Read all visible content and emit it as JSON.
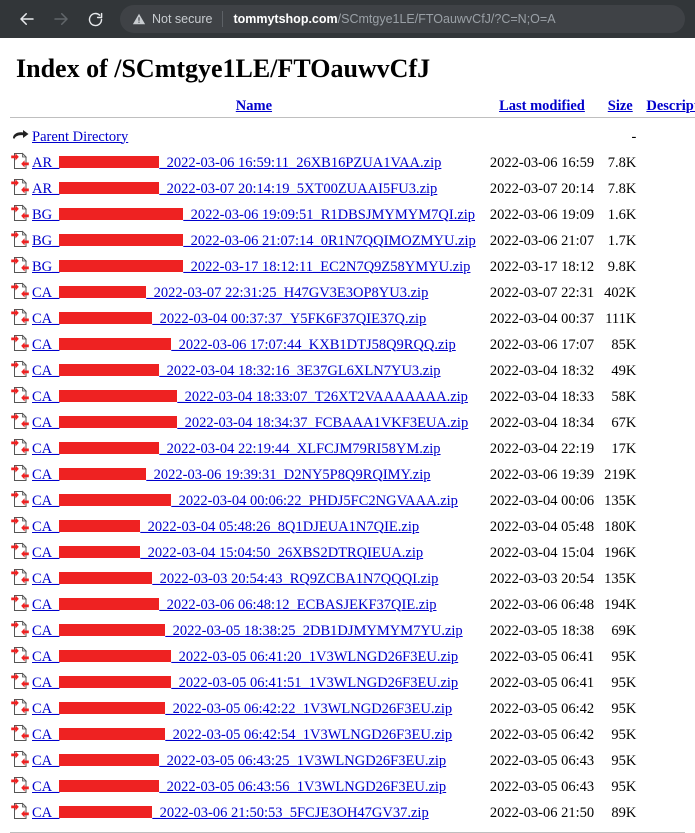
{
  "browser": {
    "back_icon": "back-arrow-icon",
    "forward_icon": "forward-arrow-icon",
    "reload_icon": "reload-icon",
    "warning_icon": "warning-triangle-icon",
    "security_label": "Not secure",
    "url_host": "tommytshop.com",
    "url_path": "/SCmtgye1LE/FTOauwvCfJ/?C=N;O=A",
    "url_full": "tommytshop.com/SCmtgye1LE/FTOauwvCfJ/?C=N;O=A"
  },
  "page": {
    "title": "Index of /SCmtgye1LE/FTOauwvCfJ"
  },
  "headers": {
    "name": "Name",
    "last_modified": "Last modified",
    "size": "Size",
    "description": "Description"
  },
  "parent": {
    "label": "Parent Directory",
    "size": "-",
    "icon": "parent-directory-icon"
  },
  "file_icon": "zip-file-icon",
  "rows": [
    {
      "prefix": "AR_",
      "redact_width": 100,
      "suffix": "_2022-03-06 16:59:11_26XB16PZUA1VAA.zip",
      "modified": "2022-03-06 16:59",
      "size": "7.8K",
      "description": ""
    },
    {
      "prefix": "AR_",
      "redact_width": 100,
      "suffix": "_2022-03-07 20:14:19_5XT00ZUAAI5FU3.zip",
      "modified": "2022-03-07 20:14",
      "size": "7.8K",
      "description": ""
    },
    {
      "prefix": "BG_",
      "redact_width": 124,
      "suffix": "_2022-03-06 19:09:51_R1DBSJMYMYM7QI.zip",
      "modified": "2022-03-06 19:09",
      "size": "1.6K",
      "description": ""
    },
    {
      "prefix": "BG_",
      "redact_width": 124,
      "suffix": "_2022-03-06 21:07:14_0R1N7QQIMOZMYU.zip",
      "modified": "2022-03-06 21:07",
      "size": "1.7K",
      "description": ""
    },
    {
      "prefix": "BG_",
      "redact_width": 124,
      "suffix": "_2022-03-17 18:12:11_EC2N7Q9Z58YMYU.zip",
      "modified": "2022-03-17 18:12",
      "size": "9.8K",
      "description": ""
    },
    {
      "prefix": "CA_",
      "redact_width": 87,
      "suffix": "_2022-03-07 22:31:25_H47GV3E3OP8YU3.zip",
      "modified": "2022-03-07 22:31",
      "size": "402K",
      "description": ""
    },
    {
      "prefix": "CA_",
      "redact_width": 93,
      "suffix": "_2022-03-04 00:37:37_Y5FK6F37QIE37Q.zip",
      "modified": "2022-03-04 00:37",
      "size": "111K",
      "description": ""
    },
    {
      "prefix": "CA_",
      "redact_width": 112,
      "suffix": "_2022-03-06 17:07:44_KXB1DTJ58Q9RQQ.zip",
      "modified": "2022-03-06 17:07",
      "size": "85K",
      "description": ""
    },
    {
      "prefix": "CA_",
      "redact_width": 100,
      "suffix": "_2022-03-04 18:32:16_3E37GL6XLN7YU3.zip",
      "modified": "2022-03-04 18:32",
      "size": "49K",
      "description": ""
    },
    {
      "prefix": "CA_",
      "redact_width": 118,
      "suffix": "_2022-03-04 18:33:07_T26XT2VAAAAAAA.zip",
      "modified": "2022-03-04 18:33",
      "size": "58K",
      "description": ""
    },
    {
      "prefix": "CA_",
      "redact_width": 118,
      "suffix": "_2022-03-04 18:34:37_FCBAAA1VKF3EUA.zip",
      "modified": "2022-03-04 18:34",
      "size": "67K",
      "description": ""
    },
    {
      "prefix": "CA_",
      "redact_width": 100,
      "suffix": "_2022-03-04 22:19:44_XLFCJM79RI58YM.zip",
      "modified": "2022-03-04 22:19",
      "size": "17K",
      "description": ""
    },
    {
      "prefix": "CA_",
      "redact_width": 87,
      "suffix": "_2022-03-06 19:39:31_D2NY5P8Q9RQIMY.zip",
      "modified": "2022-03-06 19:39",
      "size": "219K",
      "description": ""
    },
    {
      "prefix": "CA_",
      "redact_width": 112,
      "suffix": "_2022-03-04 00:06:22_PHDJ5FC2NGVAAA.zip",
      "modified": "2022-03-04 00:06",
      "size": "135K",
      "description": ""
    },
    {
      "prefix": "CA_",
      "redact_width": 81,
      "suffix": "_2022-03-04 05:48:26_8Q1DJEUA1N7QIE.zip",
      "modified": "2022-03-04 05:48",
      "size": "180K",
      "description": ""
    },
    {
      "prefix": "CA_",
      "redact_width": 81,
      "suffix": "_2022-03-04 15:04:50_26XBS2DTRQIEUA.zip",
      "modified": "2022-03-04 15:04",
      "size": "196K",
      "description": ""
    },
    {
      "prefix": "CA_",
      "redact_width": 93,
      "suffix": "_2022-03-03 20:54:43_RQ9ZCBA1N7QQQI.zip",
      "modified": "2022-03-03 20:54",
      "size": "135K",
      "description": ""
    },
    {
      "prefix": "CA_",
      "redact_width": 100,
      "suffix": "_2022-03-06 06:48:12_ECBASJEKF37QIE.zip",
      "modified": "2022-03-06 06:48",
      "size": "194K",
      "description": ""
    },
    {
      "prefix": "CA_",
      "redact_width": 106,
      "suffix": "_2022-03-05 18:38:25_2DB1DJMYMYM7YU.zip",
      "modified": "2022-03-05 18:38",
      "size": "69K",
      "description": ""
    },
    {
      "prefix": "CA_",
      "redact_width": 112,
      "suffix": "_2022-03-05 06:41:20_1V3WLNGD26F3EU.zip",
      "modified": "2022-03-05 06:41",
      "size": "95K",
      "description": ""
    },
    {
      "prefix": "CA_",
      "redact_width": 112,
      "suffix": "_2022-03-05 06:41:51_1V3WLNGD26F3EU.zip",
      "modified": "2022-03-05 06:41",
      "size": "95K",
      "description": ""
    },
    {
      "prefix": "CA_",
      "redact_width": 106,
      "suffix": "_2022-03-05 06:42:22_1V3WLNGD26F3EU.zip",
      "modified": "2022-03-05 06:42",
      "size": "95K",
      "description": ""
    },
    {
      "prefix": "CA_",
      "redact_width": 106,
      "suffix": "_2022-03-05 06:42:54_1V3WLNGD26F3EU.zip",
      "modified": "2022-03-05 06:42",
      "size": "95K",
      "description": ""
    },
    {
      "prefix": "CA_",
      "redact_width": 100,
      "suffix": "_2022-03-05 06:43:25_1V3WLNGD26F3EU.zip",
      "modified": "2022-03-05 06:43",
      "size": "95K",
      "description": ""
    },
    {
      "prefix": "CA_",
      "redact_width": 100,
      "suffix": "_2022-03-05 06:43:56_1V3WLNGD26F3EU.zip",
      "modified": "2022-03-05 06:43",
      "size": "95K",
      "description": ""
    },
    {
      "prefix": "CA_",
      "redact_width": 93,
      "suffix": "_2022-03-06 21:50:53_5FCJE3OH47GV37.zip",
      "modified": "2022-03-06 21:50",
      "size": "89K",
      "description": ""
    }
  ],
  "colors": {
    "link": "#0000cc",
    "redaction": "#ee2222",
    "chrome_bg": "#323639",
    "omnibox_bg": "#3f4246"
  }
}
